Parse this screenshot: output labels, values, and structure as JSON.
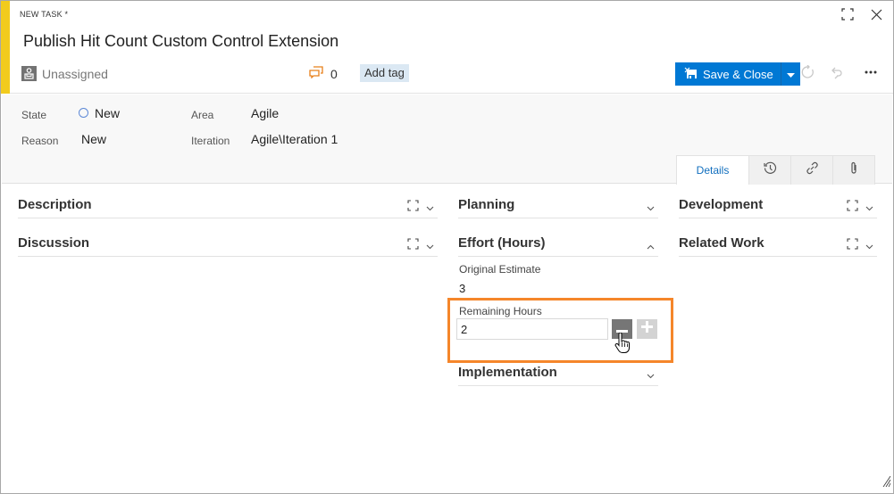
{
  "header": {
    "work_item_type": "NEW TASK *",
    "title": "Publish Hit Count Custom Control Extension",
    "assigned_to": "Unassigned",
    "comment_count": "0",
    "add_tag_label": "Add tag",
    "save_close_label": "Save & Close",
    "accent_color": "#f2cb1d",
    "primary_color": "#0078d4"
  },
  "top_icons": [
    "fullscreen-icon",
    "close-icon"
  ],
  "toolbar_icons": [
    "dropdown-arrow-icon",
    "refresh-icon",
    "undo-icon",
    "more-actions-icon"
  ],
  "fields": {
    "state_label": "State",
    "state_value": "New",
    "reason_label": "Reason",
    "reason_value": "New",
    "area_label": "Area",
    "area_value": "Agile",
    "iteration_label": "Iteration",
    "iteration_value": "Agile\\Iteration 1"
  },
  "tabs": [
    {
      "label": "Details",
      "active": true
    },
    {
      "icon": "history-icon"
    },
    {
      "icon": "links-icon"
    },
    {
      "icon": "attachment-icon"
    }
  ],
  "sections": {
    "left": [
      {
        "title": "Description"
      },
      {
        "title": "Discussion"
      }
    ],
    "middle": [
      {
        "title": "Planning"
      },
      {
        "title": "Effort (Hours)",
        "expanded": true
      },
      {
        "title": "Implementation"
      }
    ],
    "right": [
      {
        "title": "Development"
      },
      {
        "title": "Related Work"
      }
    ]
  },
  "effort": {
    "original_estimate_label": "Original Estimate",
    "original_estimate_value": "3",
    "remaining_hours_label": "Remaining Hours",
    "remaining_hours_value": "2",
    "highlight_color": "#f5862a"
  }
}
